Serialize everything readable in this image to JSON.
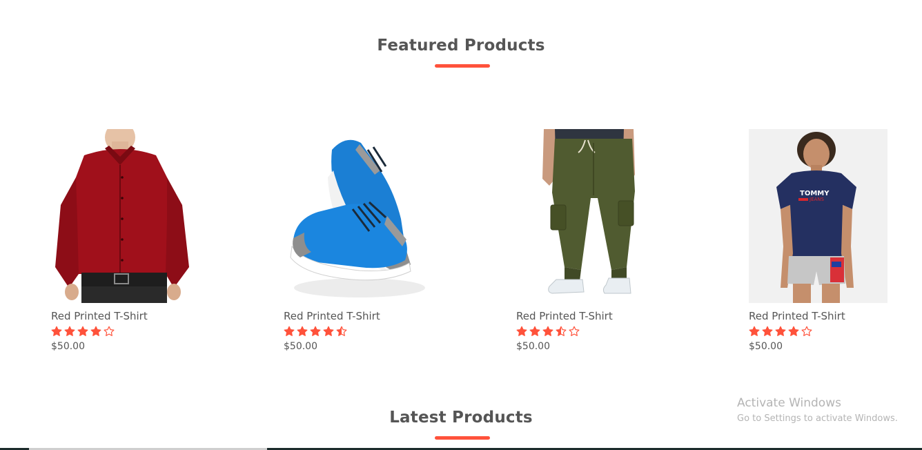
{
  "featured": {
    "title": "Featured Products"
  },
  "latest": {
    "title": "Latest Products"
  },
  "accent_color": "#ff523b",
  "products": [
    {
      "name": "Red Printed T-Shirt",
      "price": "$50.00",
      "rating": 4,
      "image": "red-shirt-image"
    },
    {
      "name": "Red Printed T-Shirt",
      "price": "$50.00",
      "rating": 4.5,
      "image": "blue-sneakers-image"
    },
    {
      "name": "Red Printed T-Shirt",
      "price": "$50.00",
      "rating": 3.5,
      "image": "green-cargo-pants-image"
    },
    {
      "name": "Red Printed T-Shirt",
      "price": "$50.00",
      "rating": 4,
      "image": "navy-tommy-tshirt-image"
    }
  ],
  "watermark": {
    "title": "Activate Windows",
    "subtitle": "Go to Settings to activate Windows."
  }
}
